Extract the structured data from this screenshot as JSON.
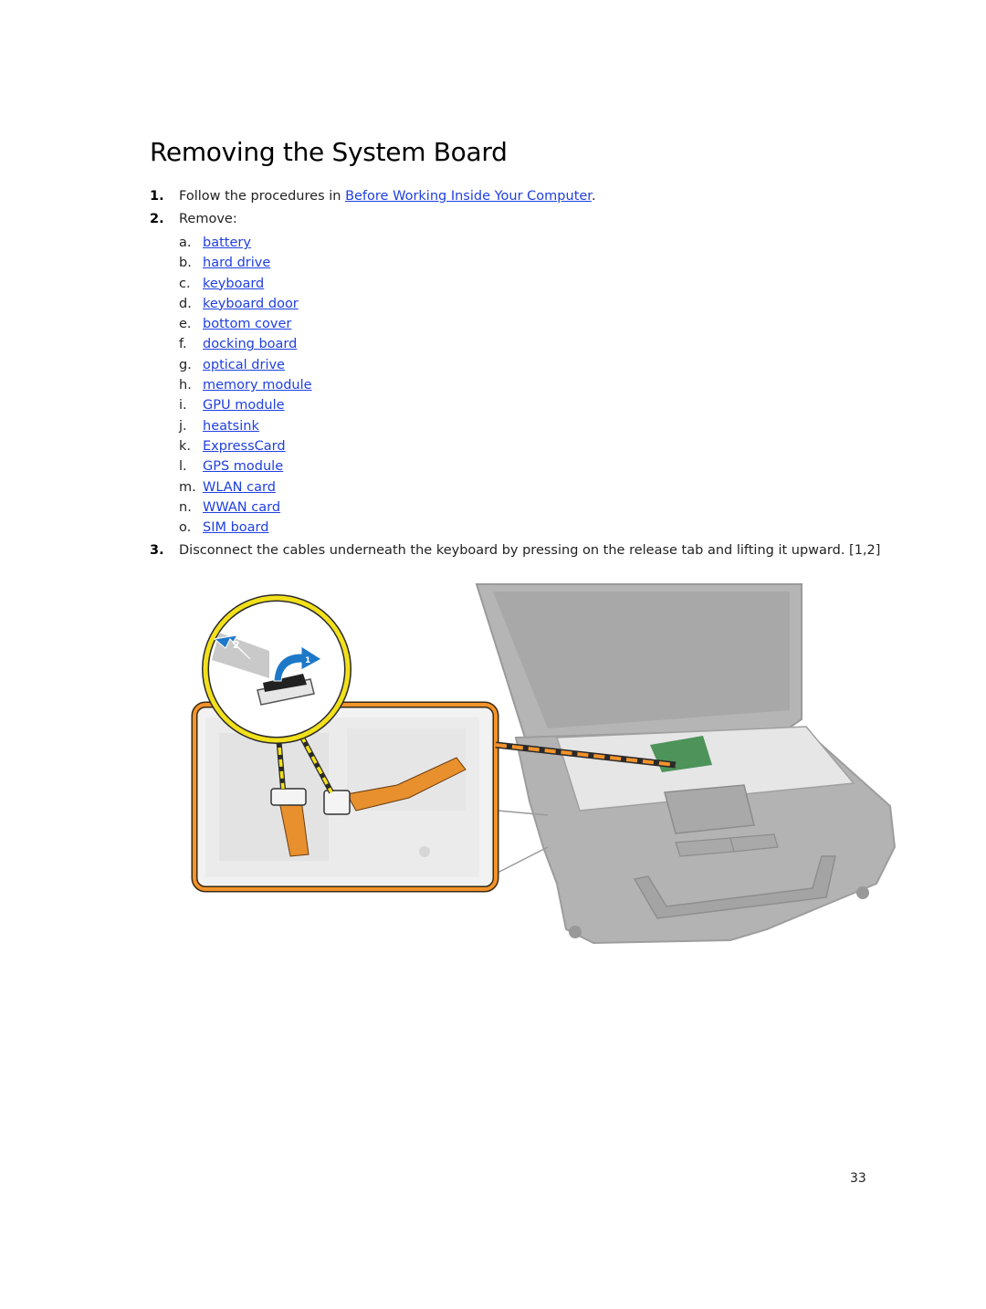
{
  "page": {
    "title": "Removing the System Board",
    "page_number": "33"
  },
  "steps": [
    {
      "number": "1.",
      "text_before": "Follow the procedures in ",
      "link": "Before Working Inside Your Computer",
      "text_after": "."
    },
    {
      "number": "2.",
      "text": "Remove:",
      "items": [
        {
          "letter": "a.",
          "label": "battery"
        },
        {
          "letter": "b.",
          "label": "hard drive"
        },
        {
          "letter": "c.",
          "label": "keyboard"
        },
        {
          "letter": "d.",
          "label": "keyboard door"
        },
        {
          "letter": "e.",
          "label": "bottom cover"
        },
        {
          "letter": "f.",
          "label": "docking board"
        },
        {
          "letter": "g.",
          "label": "optical drive"
        },
        {
          "letter": "h.",
          "label": "memory module"
        },
        {
          "letter": "i.",
          "label": "GPU module"
        },
        {
          "letter": "j.",
          "label": "heatsink"
        },
        {
          "letter": "k.",
          "label": "ExpressCard"
        },
        {
          "letter": "l.",
          "label": "GPS module"
        },
        {
          "letter": "m.",
          "label": "WLAN card"
        },
        {
          "letter": "n.",
          "label": "WWAN card"
        },
        {
          "letter": "o.",
          "label": "SIM board"
        }
      ]
    },
    {
      "number": "3.",
      "text": "Disconnect the cables underneath the keyboard by pressing on the release tab and lifting it upward. [1,2]"
    }
  ],
  "figure": {
    "callout_labels": [
      "1",
      "2"
    ],
    "colors": {
      "callout_circle": "#f2e01a",
      "inset_frame": "#f3932b",
      "arrow": "#1e78c8",
      "flex_cable": "#e8902e",
      "laptop_gray": "#a9a9a9",
      "board_green": "#3c8a4a"
    }
  }
}
